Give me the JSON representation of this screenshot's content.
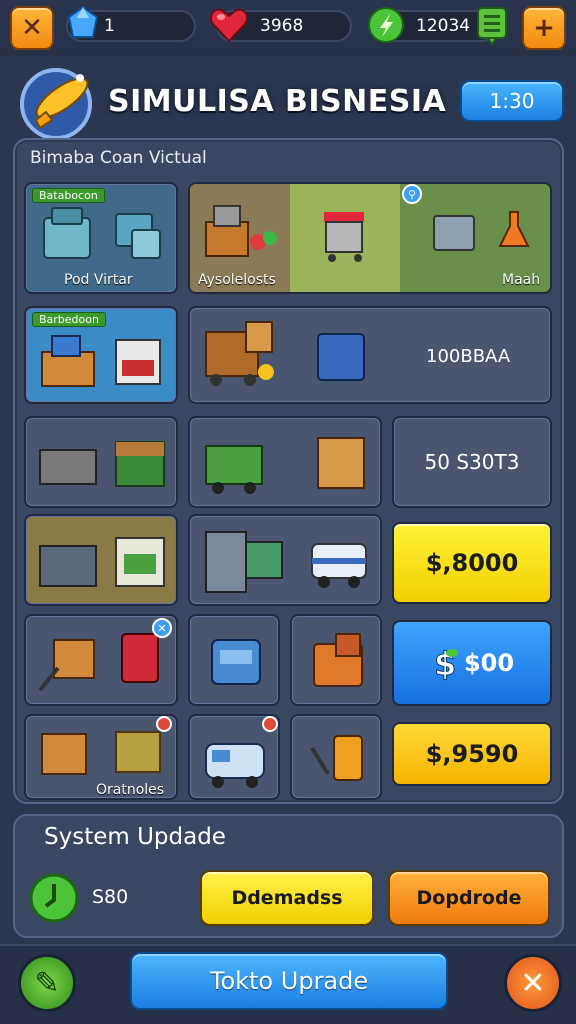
{
  "header": {
    "gems": "1",
    "hearts": "3968",
    "cash": "12034",
    "app_title": "SIMULISA BISNESIA",
    "timer": "1:30",
    "colors": {
      "accent_orange": "#f5a623",
      "accent_blue": "#1f8ef0",
      "gem": "#46a8ff",
      "heart": "#e0263a",
      "money": "#4cc43a"
    }
  },
  "panel": {
    "label": "Bimaba Coan Victual",
    "rows": [
      {
        "tag": "Batabocon",
        "caption": "Pod Virtar"
      },
      {
        "caption_left": "Aysolelosts",
        "caption_right": "Maah"
      },
      {
        "tag": "Barbedoon",
        "value": "100BBAA"
      },
      {
        "value": "50 S30T3"
      },
      {
        "price": "$,8000"
      },
      {
        "price": "$00"
      },
      {
        "caption": "Oratnoles",
        "price": "$,9590"
      }
    ]
  },
  "system": {
    "title": "System Updade",
    "value": "S80",
    "btn_left": "Ddemadss",
    "btn_right": "Dopdrode"
  },
  "footer": {
    "main_button": "Tokto Uprade"
  }
}
